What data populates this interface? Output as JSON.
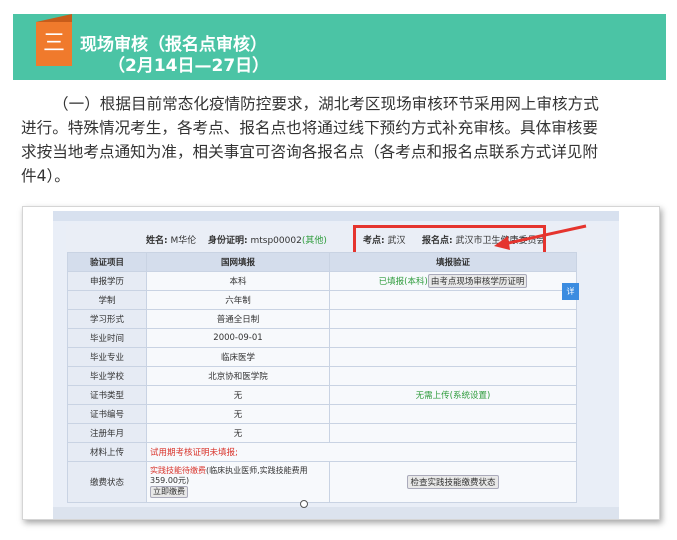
{
  "banner": {
    "badge": "三",
    "title": "现场审核（报名点审核）",
    "subtitle": "（2月14日—27日）"
  },
  "paragraph": {
    "line1": "（一）根据目前常态化疫情防控要求，湖北考区现场审核环节采用网上审核方式",
    "line2": "进行。特殊情况考生，各考点、报名点也将通过线下预约方式补充审核。具体审核要",
    "line3": "求按当地考点通知为准，相关事宜可咨询各报名点（各考点和报名点联系方式详见附",
    "line4": "件4）。"
  },
  "screenshot": {
    "info": {
      "name_label": "姓名:",
      "name_value": "M华伦",
      "id_label": "身份证明:",
      "id_value": "mtsp00002",
      "id_tag": "(其他)",
      "site_label": "考点:",
      "site_value": "武汉",
      "point_label": "报名点:",
      "point_value": "武汉市卫生健康委员会"
    },
    "columns": [
      "验证项目",
      "国网填报",
      "填报验证"
    ],
    "rows": [
      {
        "label": "申报学历",
        "mid": "本科",
        "right_status": "已填报(本科)",
        "right_btn": "由考点现场审核学历证明"
      },
      {
        "label": "学制",
        "mid": "六年制",
        "right_status": "",
        "right_btn": ""
      },
      {
        "label": "学习形式",
        "mid": "普通全日制",
        "right_status": "",
        "right_btn": ""
      },
      {
        "label": "毕业时间",
        "mid": "2000-09-01",
        "right_status": "",
        "right_btn": ""
      },
      {
        "label": "毕业专业",
        "mid": "临床医学",
        "right_status": "",
        "right_btn": ""
      },
      {
        "label": "毕业学校",
        "mid": "北京协和医学院",
        "right_status": "",
        "right_btn": ""
      },
      {
        "label": "证书类型",
        "mid": "无",
        "right_status": "无需上传(系统设置)",
        "right_btn": ""
      },
      {
        "label": "证书编号",
        "mid": "无",
        "right_status": "",
        "right_btn": ""
      },
      {
        "label": "注册年月",
        "mid": "无",
        "right_status": "",
        "right_btn": ""
      }
    ],
    "material": {
      "label": "材料上传",
      "note": "试用期考核证明未填报;"
    },
    "fee": {
      "label": "缴费状态",
      "line1": "实践技能待缴费",
      "line1_rest": "(临床执业医师,实践技能费用",
      "line2": "359.00元)",
      "pay_btn": "立即缴费",
      "check_btn": "检查实践技能缴费状态"
    },
    "side_btn": "详"
  }
}
